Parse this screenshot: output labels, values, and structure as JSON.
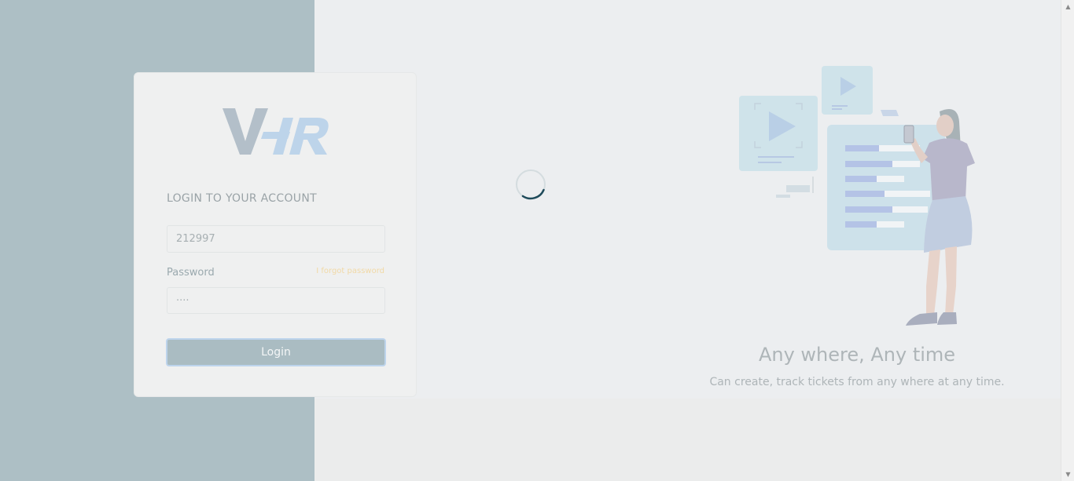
{
  "colors": {
    "left_panel": "#adbfc5",
    "background": "#eceef0",
    "card": "#eff0f0",
    "button": "#aabcc2",
    "forgot_link": "#f1d9a6",
    "spinner": "#1f4b5b",
    "logo": "#b3bfc9",
    "logo_accent": "#bdd4ea"
  },
  "brand": {
    "logo_text": "V-HR"
  },
  "login": {
    "heading": "LOGIN TO YOUR ACCOUNT",
    "username_value": "212997",
    "password_label": "Password",
    "forgot_label": "I forgot password",
    "password_value": "····",
    "button_label": "Login"
  },
  "status": {
    "spinner_icon": "loading-spinner-icon"
  },
  "promo": {
    "title": "Any where, Any time",
    "subtitle": "Can create, track tickets from any where at any time."
  },
  "scrollbar": {
    "up_icon": "▲",
    "down_icon": "▼"
  }
}
